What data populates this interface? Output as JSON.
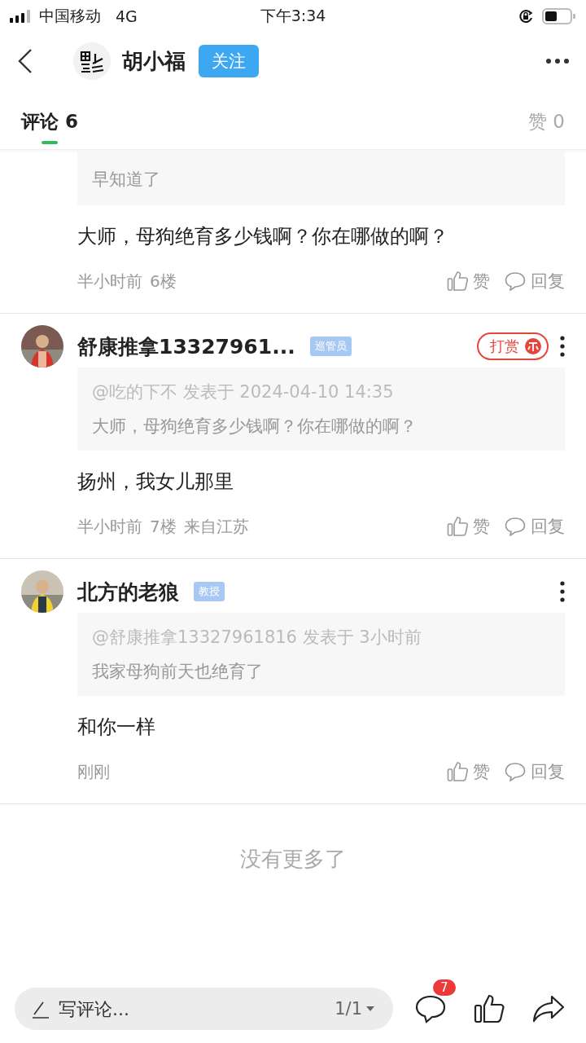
{
  "status_bar": {
    "carrier": "中国移动",
    "network": "4G",
    "time": "下午3:34"
  },
  "header": {
    "title": "胡小福",
    "follow_button": "关注"
  },
  "tabs": [
    {
      "label": "评论 6",
      "selected": true
    },
    {
      "label": "赞 0",
      "selected": false
    }
  ],
  "comments": [
    {
      "kind": "partial",
      "quote": {
        "text": "早知道了"
      },
      "body": "大师，母狗绝育多少钱啊？你在哪做的啊？",
      "meta": [
        "半小时前",
        "6楼"
      ],
      "like": "赞",
      "reply": "回复"
    },
    {
      "kind": "full",
      "author": "舒康推拿13327961...",
      "badge": "巡管员",
      "reward": "打赏",
      "quote": {
        "header": "@吃的下不 发表于 2024-04-10 14:35",
        "text": "大师，母狗绝育多少钱啊？你在哪做的啊？"
      },
      "body": "扬州，我女儿那里",
      "meta": [
        "半小时前",
        "7楼",
        "来自江苏"
      ],
      "like": "赞",
      "reply": "回复"
    },
    {
      "kind": "full",
      "author": "北方的老狼",
      "badge": "教授",
      "quote": {
        "header": "@舒康推拿13327961816 发表于 3小时前",
        "text": "我家母狗前天也绝育了"
      },
      "body": "和你一样",
      "meta": [
        "刚刚"
      ],
      "like": "赞",
      "reply": "回复"
    }
  ],
  "end_note": "没有更多了",
  "bottom_bar": {
    "placeholder": "写评论...",
    "page": "1/1",
    "comment_count": "7"
  }
}
